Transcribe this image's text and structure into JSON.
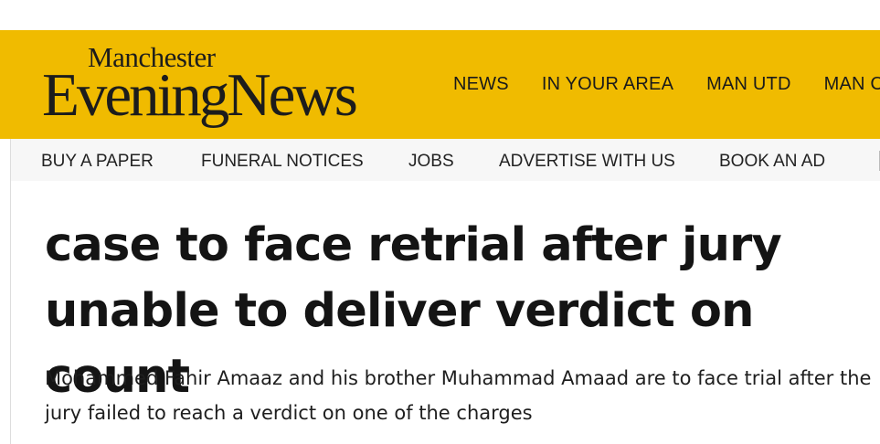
{
  "brand": {
    "name_top": "Manchester",
    "name_bottom": "EveningNews",
    "color": "#f0bb00"
  },
  "main_nav": {
    "items": [
      {
        "label": "NEWS"
      },
      {
        "label": "IN YOUR AREA"
      },
      {
        "label": "MAN UTD"
      },
      {
        "label": "MAN CITY"
      }
    ]
  },
  "sub_nav": {
    "items": [
      {
        "label": "BUY A PAPER"
      },
      {
        "label": "FUNERAL NOTICES"
      },
      {
        "label": "JOBS"
      },
      {
        "label": "ADVERTISE WITH US"
      },
      {
        "label": "BOOK AN AD"
      }
    ]
  },
  "article": {
    "headline": "case to face retrial after jury unable to deliver verdict on count",
    "standfirst": "Mohammed Fahir Amaaz and his brother Muhammad Amaad are to face trial after the jury failed to reach a verdict on one of the charges"
  }
}
